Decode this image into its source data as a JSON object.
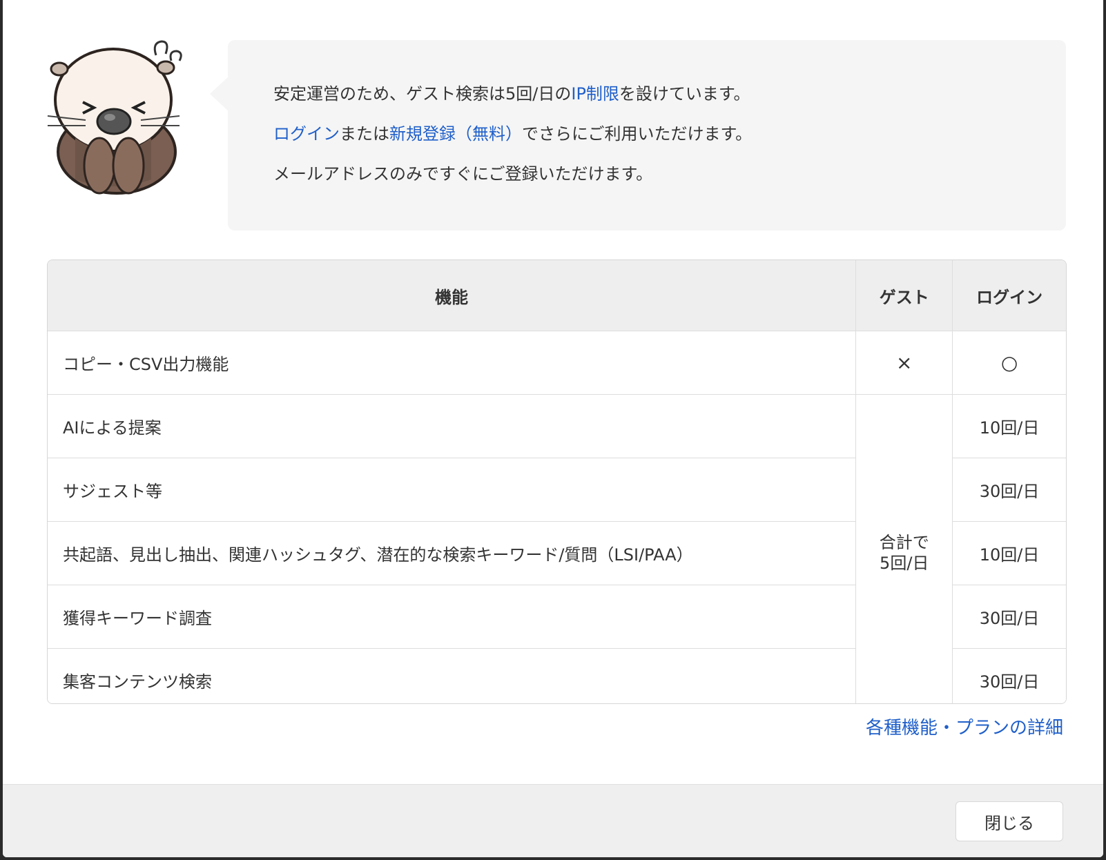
{
  "message": {
    "line1_pre": "安定運営のため、ゲスト検索は5回/日の",
    "line1_link": "IP制限",
    "line1_post": "を設けています。",
    "line2_link1": "ログイン",
    "line2_mid": "または",
    "line2_link2": "新規登録（無料）",
    "line2_post": "でさらにご利用いただけます。",
    "line3": "メールアドレスのみですぐにご登録いただけます。"
  },
  "table": {
    "headers": [
      "機能",
      "ゲスト",
      "ログイン"
    ],
    "rows": [
      {
        "feature": "コピー・CSV出力機能",
        "guest": "×",
        "login": "○"
      },
      {
        "feature": "AIによる提案",
        "login": "10回/日"
      },
      {
        "feature": "サジェスト等",
        "login": "30回/日"
      },
      {
        "feature": "共起語、見出し抽出、関連ハッシュタグ、潜在的な検索キーワード/質問（LSI/PAA）",
        "login": "10回/日"
      },
      {
        "feature": "獲得キーワード調査",
        "login": "30回/日"
      },
      {
        "feature": "集客コンテンツ検索",
        "login": "30回/日"
      }
    ],
    "guest_merged_line1": "合計で",
    "guest_merged_line2": "5回/日"
  },
  "detail_link": "各種機能・プランの詳細",
  "footer": {
    "close_label": "閉じる"
  },
  "colors": {
    "link": "#1f5fc9",
    "bubble_bg": "#f5f5f5",
    "header_bg": "#eeeeee",
    "footer_bg": "#efefef"
  },
  "mascot_icon": "sea-otter-mascot-icon"
}
